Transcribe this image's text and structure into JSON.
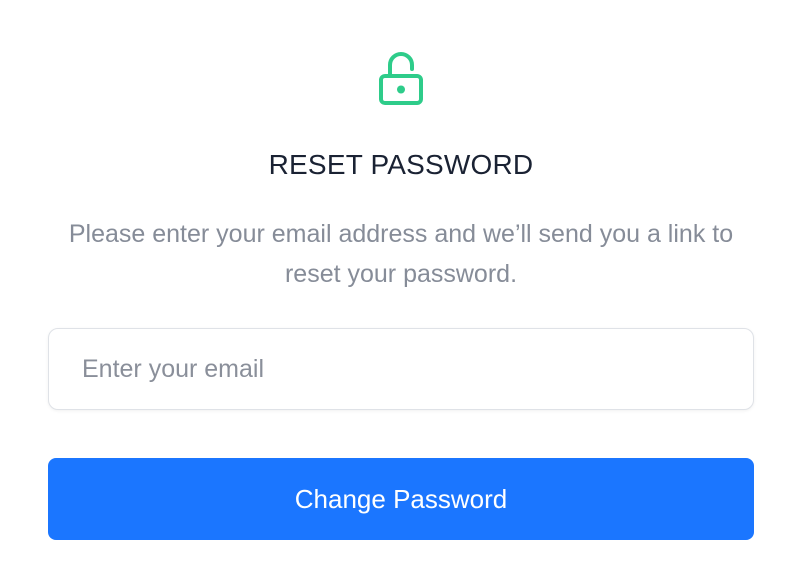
{
  "header": {
    "icon": "unlocked-padlock-icon",
    "title": "RESET PASSWORD"
  },
  "description": "Please enter your email address and we’ll send you a link to reset your password.",
  "email": {
    "value": "",
    "placeholder": "Enter your email"
  },
  "submit": {
    "label": "Change Password"
  },
  "colors": {
    "accent": "#1b76ff",
    "icon": "#2ecc8a",
    "title": "#1a2233",
    "muted": "#868c98"
  }
}
